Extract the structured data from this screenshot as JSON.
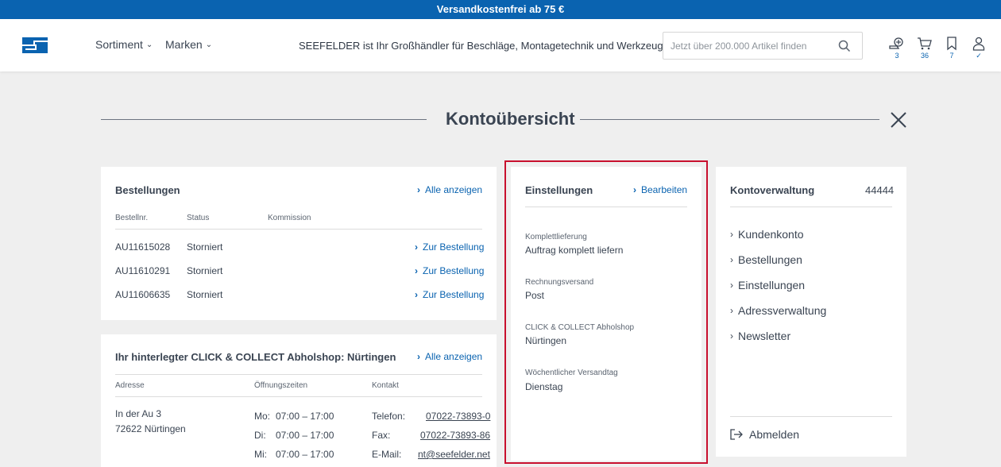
{
  "topbar": {
    "text": "Versandkostenfrei ab 75 €"
  },
  "header": {
    "nav": [
      {
        "label": "Sortiment"
      },
      {
        "label": "Marken"
      }
    ],
    "tagline": "SEEFELDER ist Ihr Großhändler für Beschläge, Montagetechnik und Werkzeuge.",
    "search_placeholder": "Jetzt über 200.000 Artikel finden",
    "icons": [
      {
        "name": "compare-icon",
        "count": "3"
      },
      {
        "name": "cart-icon",
        "count": "36"
      },
      {
        "name": "bookmark-icon",
        "count": "7"
      },
      {
        "name": "user-icon",
        "count": "✓"
      }
    ],
    "brand_color": "#0a63b0"
  },
  "page": {
    "title": "Kontoübersicht"
  },
  "orders": {
    "title": "Bestellungen",
    "show_all": "Alle anzeigen",
    "columns": [
      "Bestellnr.",
      "Status",
      "Kommission"
    ],
    "rows": [
      {
        "nr": "AU11615028",
        "status": "Storniert",
        "link": "Zur Bestellung"
      },
      {
        "nr": "AU11610291",
        "status": "Storniert",
        "link": "Zur Bestellung"
      },
      {
        "nr": "AU11606635",
        "status": "Storniert",
        "link": "Zur Bestellung"
      }
    ]
  },
  "shop": {
    "title": "Ihr hinterlegter CLICK & COLLECT Abholshop: Nürtingen",
    "show_all": "Alle anzeigen",
    "columns": [
      "Adresse",
      "Öffnungszeiten",
      "Kontakt"
    ],
    "address": [
      "In der Au 3",
      "72622 Nürtingen"
    ],
    "hours": [
      {
        "day": "Mo:",
        "time": "07:00 – 17:00"
      },
      {
        "day": "Di:",
        "time": "07:00 – 17:00"
      },
      {
        "day": "Mi:",
        "time": "07:00 – 17:00"
      }
    ],
    "contact": [
      {
        "label": "Telefon:",
        "value": "07022-73893-0"
      },
      {
        "label": "Fax:",
        "value": "07022-73893-86"
      },
      {
        "label": "E-Mail:",
        "value": "nt@seefelder.net"
      }
    ]
  },
  "settings": {
    "title": "Einstellungen",
    "edit": "Bearbeiten",
    "items": [
      {
        "label": "Komplettlieferung",
        "value": "Auftrag komplett liefern"
      },
      {
        "label": "Rechnungsversand",
        "value": "Post"
      },
      {
        "label": "CLICK & COLLECT Abholshop",
        "value": "Nürtingen"
      },
      {
        "label": "Wöchentlicher Versandtag",
        "value": "Dienstag"
      }
    ],
    "highlight_color": "#c8102e"
  },
  "account": {
    "title": "Kontoverwaltung",
    "number": "44444",
    "menu": [
      {
        "label": "Kundenkonto"
      },
      {
        "label": "Bestellungen"
      },
      {
        "label": "Einstellungen"
      },
      {
        "label": "Adressverwaltung"
      },
      {
        "label": "Newsletter"
      }
    ],
    "logout": "Abmelden"
  }
}
